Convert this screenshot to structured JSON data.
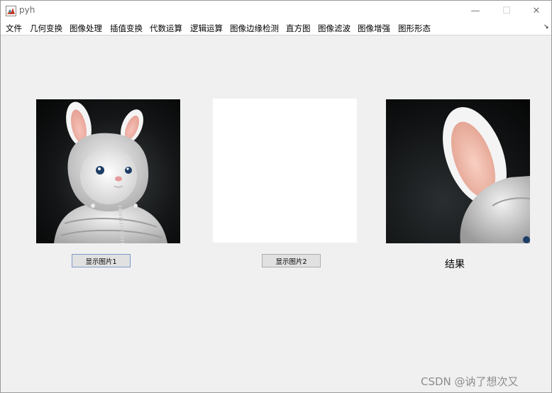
{
  "window": {
    "title": "pyh",
    "minimize": "—",
    "maximize": "☐",
    "close": "✕"
  },
  "menubar": {
    "items": [
      "文件",
      "几何变换",
      "图像处理",
      "插值变换",
      "代数运算",
      "逻辑运算",
      "图像边缘检测",
      "直方图",
      "图像滤波",
      "图像增强",
      "图形形态"
    ],
    "overflow_arrow": "↘"
  },
  "panels": [
    {
      "content": "rabbit-hoodie-photo"
    },
    {
      "content": "empty-white"
    },
    {
      "content": "rabbit-ear-zoomed-result"
    }
  ],
  "buttons": {
    "show_image1": "显示图片1",
    "show_image2": "显示图片2"
  },
  "result_label": "结果",
  "watermark": "CSDN @讷了想次又"
}
